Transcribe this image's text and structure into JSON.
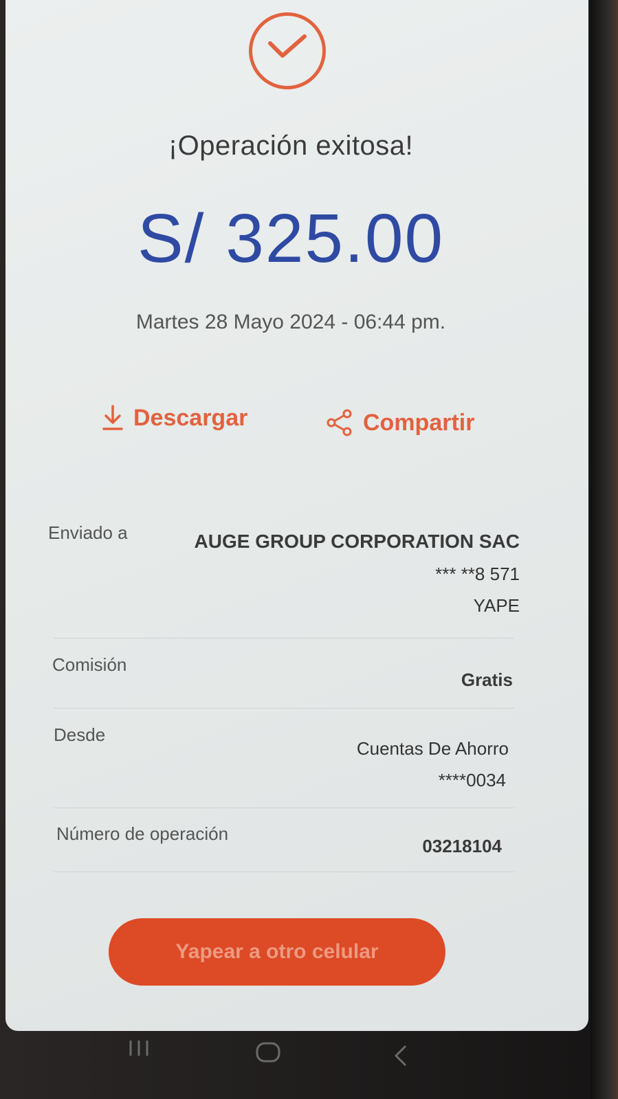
{
  "header": {
    "icon": "check-circle-icon",
    "title": "¡Operación exitosa!"
  },
  "amount": "S/ 325.00",
  "datetime": "Martes 28 Mayo 2024 - 06:44 pm.",
  "actions": {
    "download_label": "Descargar",
    "share_label": "Compartir"
  },
  "details": {
    "sent_to": {
      "label": "Enviado a",
      "name": "AUGE GROUP CORPORATION SAC",
      "phone": "*** **8 571",
      "method": "YAPE"
    },
    "commission": {
      "label": "Comisión",
      "value": "Gratis"
    },
    "from": {
      "label": "Desde",
      "account": "Cuentas De Ahorro",
      "number": "****0034"
    },
    "operation_number": {
      "label": "Número de operación",
      "value": "03218104"
    }
  },
  "cta": {
    "label": "Yapear a otro celular"
  },
  "colors": {
    "accent": "#e2623f",
    "amount": "#2f4aa3",
    "cta_bg": "#dd4a26"
  }
}
